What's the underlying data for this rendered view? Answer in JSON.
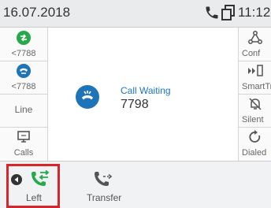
{
  "status": {
    "date": "16.07.2018",
    "time": "11:12"
  },
  "left_keys": [
    {
      "label": "<7788",
      "icon": "green-call-icon"
    },
    {
      "label": "<7788",
      "icon": "blue-hold-call-icon"
    },
    {
      "label": "Line"
    },
    {
      "label": "Calls",
      "icon": "monitor-icon"
    }
  ],
  "right_keys": [
    {
      "label": "Conf",
      "icon": "conference-icon"
    },
    {
      "label": "SmartTr",
      "icon": "smart-transfer-icon"
    },
    {
      "label": "Silent",
      "icon": "bell-off-icon"
    },
    {
      "label": "Dialed",
      "icon": "redial-icon"
    }
  ],
  "call": {
    "status": "Call Waiting",
    "number": "7798"
  },
  "bottom": {
    "left_label": "Left",
    "transfer_label": "Transfer"
  },
  "colors": {
    "accent": "#1f74b8",
    "green": "#27a84a",
    "highlight": "#d6262c"
  }
}
